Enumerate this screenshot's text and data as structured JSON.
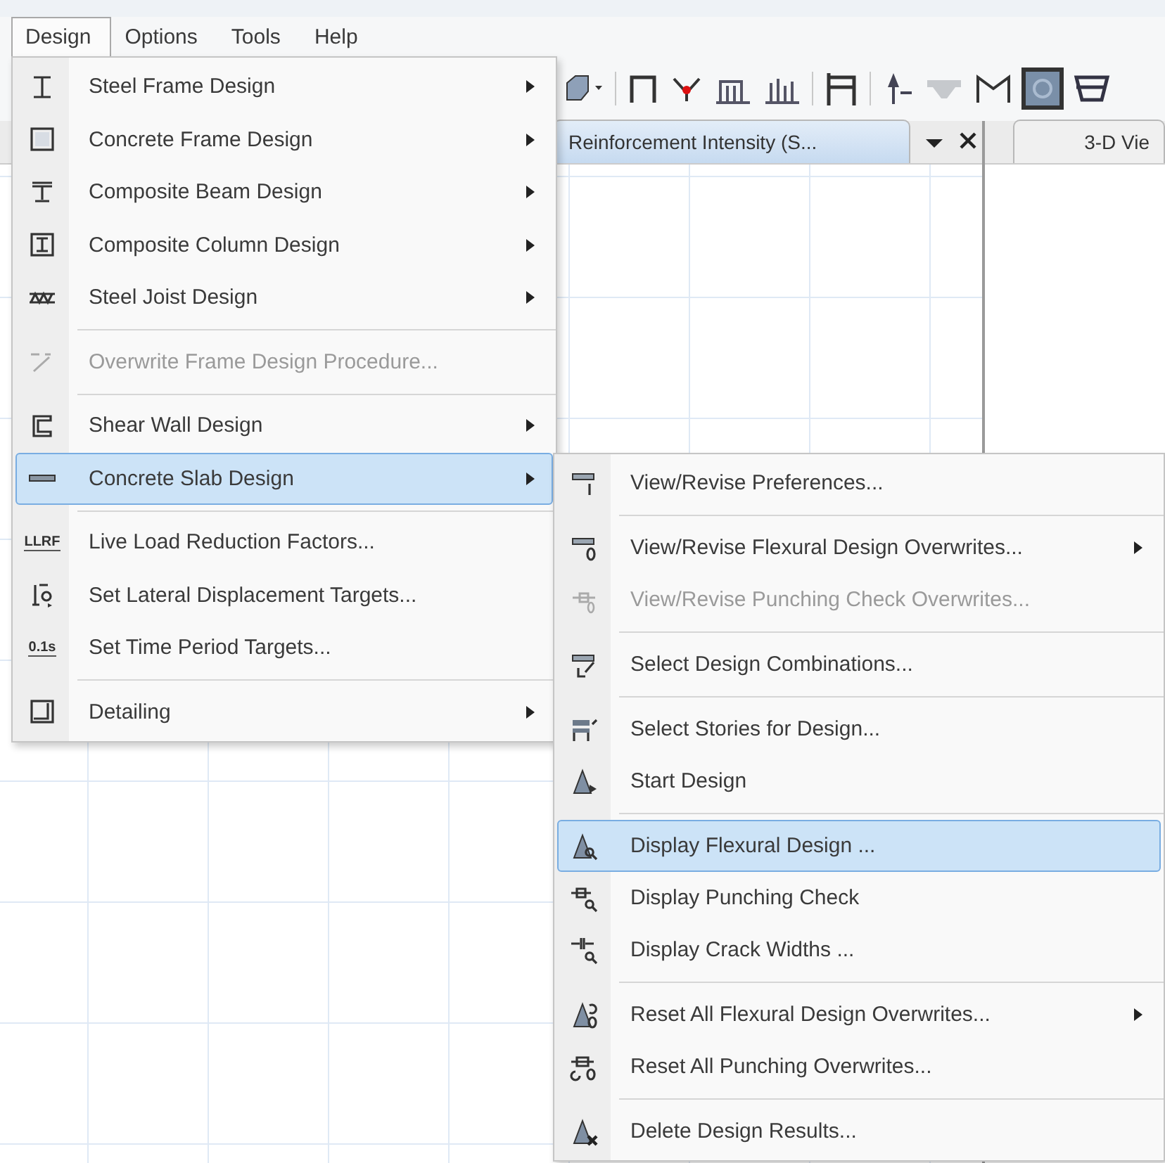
{
  "menu_bar": [
    {
      "label": "Design",
      "selected": true
    },
    {
      "label": "Options",
      "selected": false
    },
    {
      "label": "Tools",
      "selected": false
    },
    {
      "label": "Help",
      "selected": false
    }
  ],
  "document_tabs": [
    {
      "label": "Reinforcement Intensity (S...",
      "selected": true
    },
    {
      "label": "3-D Vie",
      "selected": false
    }
  ],
  "design_menu": {
    "items": [
      {
        "kind": "item",
        "label": "Steel Frame Design",
        "has_submenu": true,
        "disabled": false,
        "selected": false
      },
      {
        "kind": "item",
        "label": "Concrete Frame Design",
        "has_submenu": true,
        "disabled": false,
        "selected": false
      },
      {
        "kind": "item",
        "label": "Composite Beam Design",
        "has_submenu": true,
        "disabled": false,
        "selected": false
      },
      {
        "kind": "item",
        "label": "Composite Column Design",
        "has_submenu": true,
        "disabled": false,
        "selected": false
      },
      {
        "kind": "item",
        "label": "Steel Joist Design",
        "has_submenu": true,
        "disabled": false,
        "selected": false
      },
      {
        "kind": "separator"
      },
      {
        "kind": "item",
        "label": "Overwrite Frame Design Procedure...",
        "has_submenu": false,
        "disabled": true,
        "selected": false
      },
      {
        "kind": "separator"
      },
      {
        "kind": "item",
        "label": "Shear Wall Design",
        "has_submenu": true,
        "disabled": false,
        "selected": false
      },
      {
        "kind": "item",
        "label": "Concrete Slab Design",
        "has_submenu": true,
        "disabled": false,
        "selected": true
      },
      {
        "kind": "separator"
      },
      {
        "kind": "item",
        "label": "Live Load Reduction Factors...",
        "icon_text": "LLRF",
        "has_submenu": false,
        "disabled": false,
        "selected": false
      },
      {
        "kind": "item",
        "label": "Set Lateral Displacement Targets...",
        "has_submenu": false,
        "disabled": false,
        "selected": false
      },
      {
        "kind": "item",
        "label": "Set Time Period Targets...",
        "icon_text": "0.1s",
        "has_submenu": false,
        "disabled": false,
        "selected": false
      },
      {
        "kind": "separator"
      },
      {
        "kind": "item",
        "label": "Detailing",
        "has_submenu": true,
        "disabled": false,
        "selected": false
      }
    ]
  },
  "slab_submenu": {
    "items": [
      {
        "kind": "item",
        "label": "View/Revise Preferences...",
        "has_submenu": false,
        "disabled": false,
        "selected": false
      },
      {
        "kind": "separator"
      },
      {
        "kind": "item",
        "label": "View/Revise Flexural Design Overwrites...",
        "has_submenu": true,
        "disabled": false,
        "selected": false
      },
      {
        "kind": "item",
        "label": "View/Revise Punching Check Overwrites...",
        "has_submenu": false,
        "disabled": true,
        "selected": false
      },
      {
        "kind": "separator"
      },
      {
        "kind": "item",
        "label": "Select Design Combinations...",
        "has_submenu": false,
        "disabled": false,
        "selected": false
      },
      {
        "kind": "separator"
      },
      {
        "kind": "item",
        "label": "Select Stories for Design...",
        "has_submenu": false,
        "disabled": false,
        "selected": false
      },
      {
        "kind": "item",
        "label": "Start Design",
        "has_submenu": false,
        "disabled": false,
        "selected": false
      },
      {
        "kind": "separator"
      },
      {
        "kind": "item",
        "label": "Display Flexural Design ...",
        "has_submenu": false,
        "disabled": false,
        "selected": true
      },
      {
        "kind": "item",
        "label": "Display Punching Check",
        "has_submenu": false,
        "disabled": false,
        "selected": false
      },
      {
        "kind": "item",
        "label": "Display Crack Widths ...",
        "has_submenu": false,
        "disabled": false,
        "selected": false
      },
      {
        "kind": "separator"
      },
      {
        "kind": "item",
        "label": "Reset All Flexural Design Overwrites...",
        "has_submenu": true,
        "disabled": false,
        "selected": false
      },
      {
        "kind": "item",
        "label": "Reset All Punching Overwrites...",
        "has_submenu": false,
        "disabled": false,
        "selected": false
      },
      {
        "kind": "separator"
      },
      {
        "kind": "item",
        "label": "Delete Design Results...",
        "has_submenu": false,
        "disabled": false,
        "selected": false
      }
    ]
  }
}
